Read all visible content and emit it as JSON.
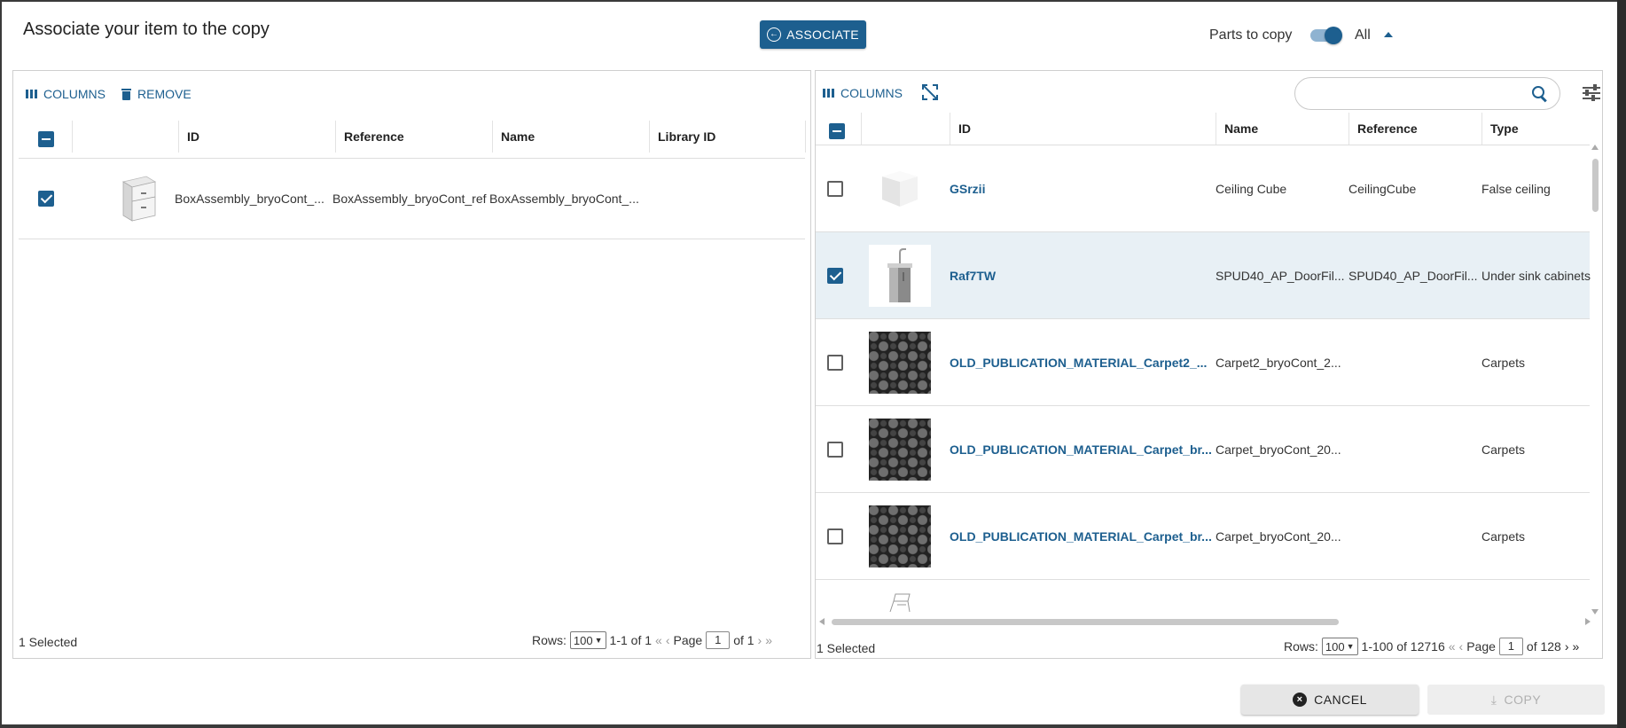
{
  "dialog": {
    "title": "Associate your item to the copy",
    "associate_label": "ASSOCIATE",
    "parts_to_copy_label": "Parts to copy",
    "parts_toggle_on": true,
    "parts_scope": "All",
    "cancel_label": "CANCEL",
    "copy_label": "COPY",
    "accent_color": "#1d5f8f"
  },
  "left_panel": {
    "columns_label": "COLUMNS",
    "remove_label": "REMOVE",
    "headers": [
      "ID",
      "Reference",
      "Name",
      "Library ID"
    ],
    "rows": [
      {
        "checked": true,
        "thumbnail": "drawer-cabinet-icon",
        "id": "BoxAssembly_bryoCont_...",
        "reference": "BoxAssembly_bryoCont_ref",
        "name": "BoxAssembly_bryoCont_...",
        "library_id": ""
      }
    ],
    "footer": {
      "selected": "1 Selected",
      "rows_label": "Rows:",
      "rows_per_page": "100",
      "range": "1-1 of 1",
      "page_label": "Page",
      "page": "1",
      "of_pages": "of 1"
    }
  },
  "right_panel": {
    "columns_label": "COLUMNS",
    "search_placeholder": "",
    "headers": [
      "ID",
      "Name",
      "Reference",
      "Type"
    ],
    "rows": [
      {
        "checked": false,
        "thumbnail": "ceiling-cube-icon",
        "id": "GSrzii",
        "name": "Ceiling Cube",
        "reference": "CeilingCube",
        "type": "False ceiling"
      },
      {
        "checked": true,
        "thumbnail": "sink-cabinet-icon",
        "id": "Raf7TW",
        "name": "SPUD40_AP_DoorFil...",
        "reference": "SPUD40_AP_DoorFil...",
        "type": "Under sink cabinets"
      },
      {
        "checked": false,
        "thumbnail": "carpet-texture",
        "id": "OLD_PUBLICATION_MATERIAL_Carpet2_...",
        "name": "Carpet2_bryoCont_2...",
        "reference": "",
        "type": "Carpets"
      },
      {
        "checked": false,
        "thumbnail": "carpet-texture",
        "id": "OLD_PUBLICATION_MATERIAL_Carpet_br...",
        "name": "Carpet_bryoCont_20...",
        "reference": "",
        "type": "Carpets"
      },
      {
        "checked": false,
        "thumbnail": "carpet-texture",
        "id": "OLD_PUBLICATION_MATERIAL_Carpet_br...",
        "name": "Carpet_bryoCont_20...",
        "reference": "",
        "type": "Carpets"
      }
    ],
    "footer": {
      "selected": "1 Selected",
      "rows_label": "Rows:",
      "rows_per_page": "100",
      "range": "1-100 of 12716",
      "page_label": "Page",
      "page": "1",
      "of_pages": "of 128"
    }
  }
}
